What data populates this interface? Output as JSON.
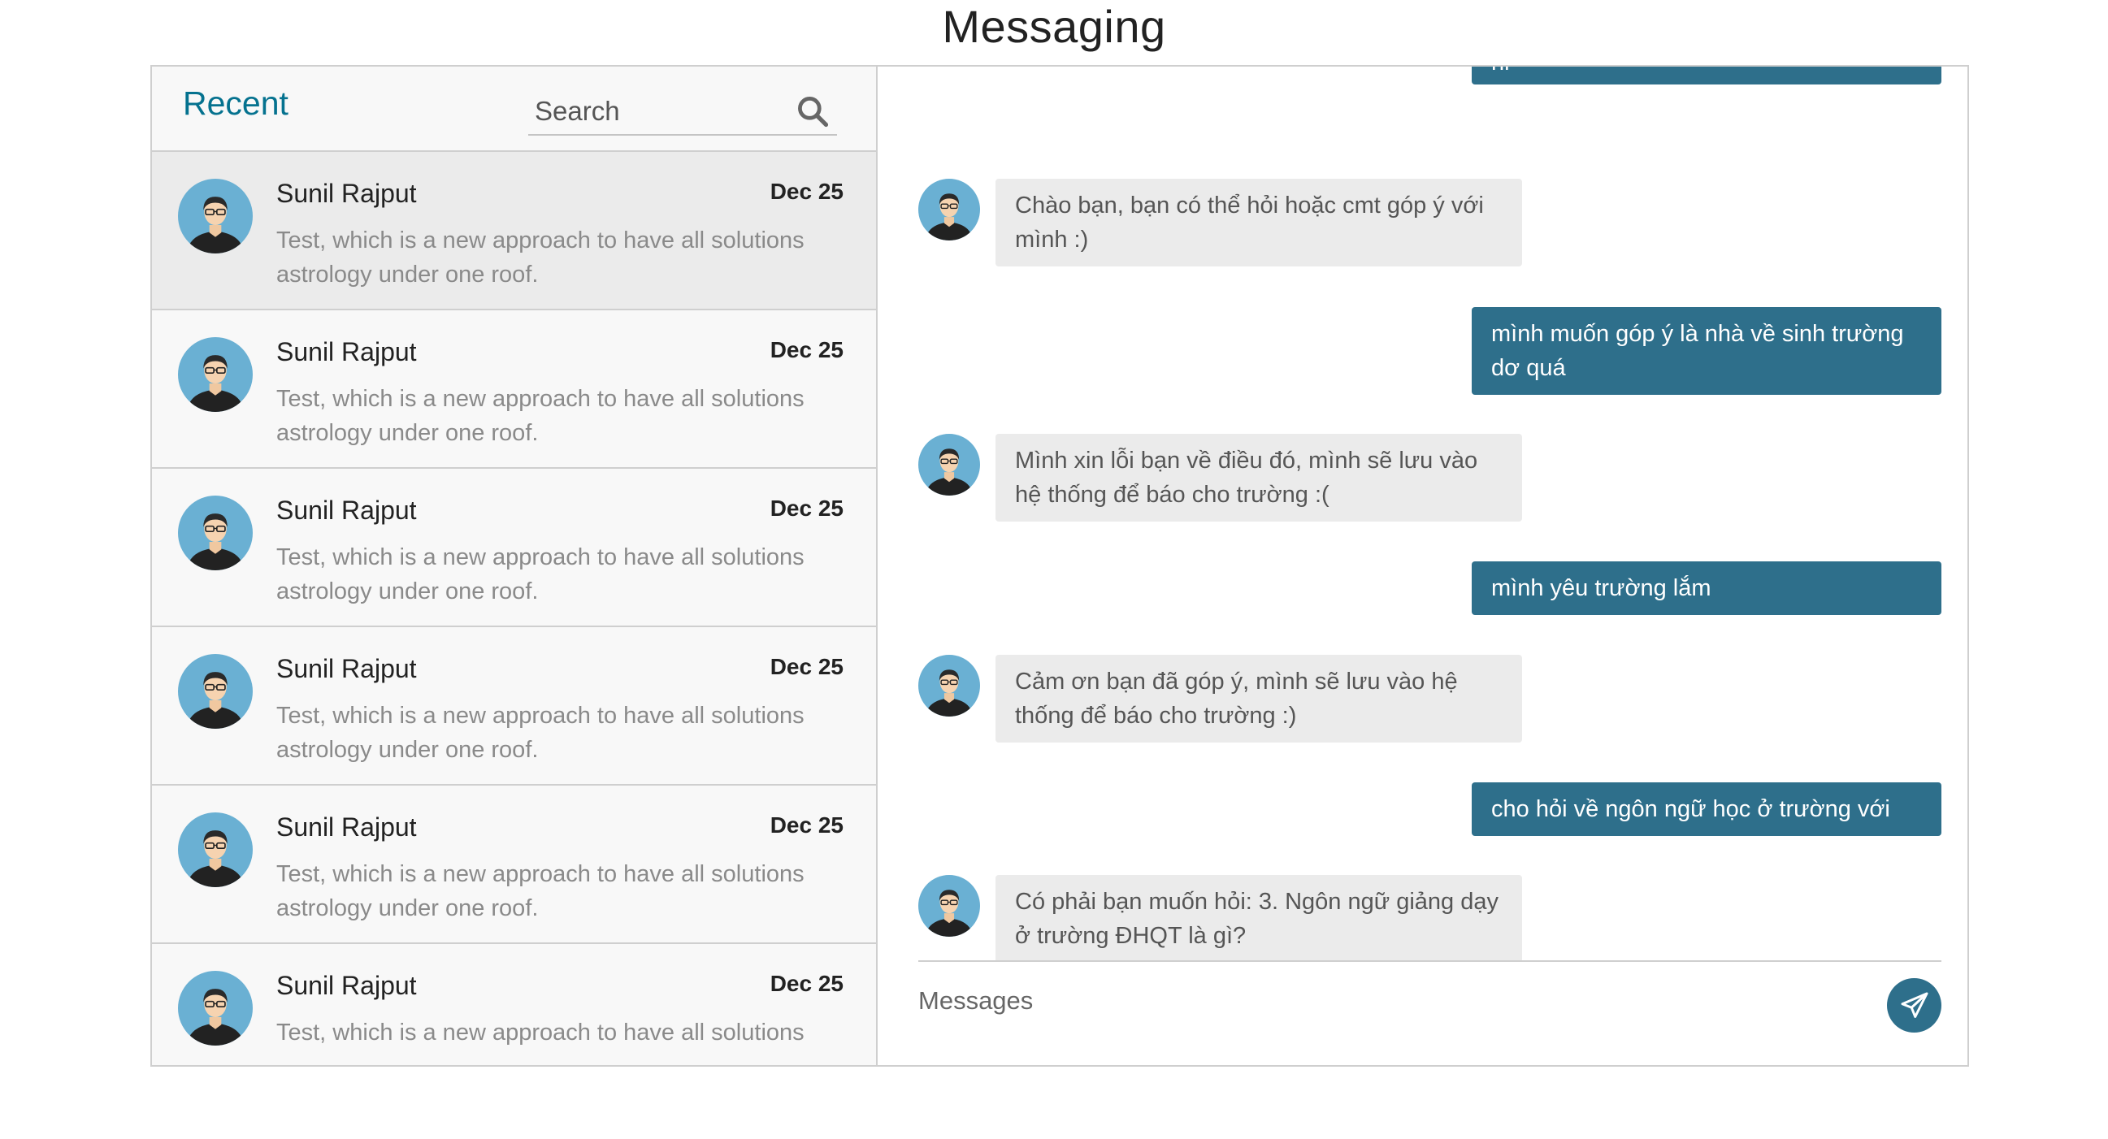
{
  "page": {
    "title": "Messaging"
  },
  "sidebar": {
    "title": "Recent",
    "search": {
      "placeholder": "Search"
    },
    "chats": [
      {
        "name": "Sunil Rajput",
        "date": "Dec 25",
        "preview": "Test, which is a new approach to have all solutions astrology under one roof.",
        "active": true
      },
      {
        "name": "Sunil Rajput",
        "date": "Dec 25",
        "preview": "Test, which is a new approach to have all solutions astrology under one roof."
      },
      {
        "name": "Sunil Rajput",
        "date": "Dec 25",
        "preview": "Test, which is a new approach to have all solutions astrology under one roof."
      },
      {
        "name": "Sunil Rajput",
        "date": "Dec 25",
        "preview": "Test, which is a new approach to have all solutions astrology under one roof."
      },
      {
        "name": "Sunil Rajput",
        "date": "Dec 25",
        "preview": "Test, which is a new approach to have all solutions astrology under one roof."
      },
      {
        "name": "Sunil Rajput",
        "date": "Dec 25",
        "preview": "Test, which is a new approach to have all solutions"
      }
    ]
  },
  "conversation": {
    "messages": [
      {
        "from": "me",
        "text": "hi"
      },
      {
        "from": "bot",
        "text": "Chào bạn, bạn có thể hỏi hoặc cmt góp ý với mình :)"
      },
      {
        "from": "me",
        "text": "mình muốn góp ý là nhà về sinh trường dơ quá"
      },
      {
        "from": "bot",
        "text": "Mình xin lỗi bạn về điều đó, mình sẽ lưu vào hệ thống để báo cho trường :("
      },
      {
        "from": "me",
        "text": "mình yêu trường lắm"
      },
      {
        "from": "bot",
        "text": "Cảm ơn bạn đã góp ý, mình sẽ lưu vào hệ thống để báo cho trường :)"
      },
      {
        "from": "me",
        "text": "cho hỏi về ngôn ngữ học ở trường với"
      },
      {
        "from": "bot",
        "text": "Có phải bạn muốn hỏi: 3. Ngôn ngữ giảng dạy ở trường ĐHQT là gì?"
      }
    ],
    "composer": {
      "placeholder": "Messages"
    }
  },
  "icons": {
    "search": "search-icon",
    "send": "paper-plane-icon",
    "avatar": "user-avatar-icon"
  },
  "colors": {
    "accent": "#05728f",
    "outgoing_bubble": "#2e6f8b",
    "incoming_bubble": "#ebebeb",
    "active_item": "#ebebeb"
  }
}
